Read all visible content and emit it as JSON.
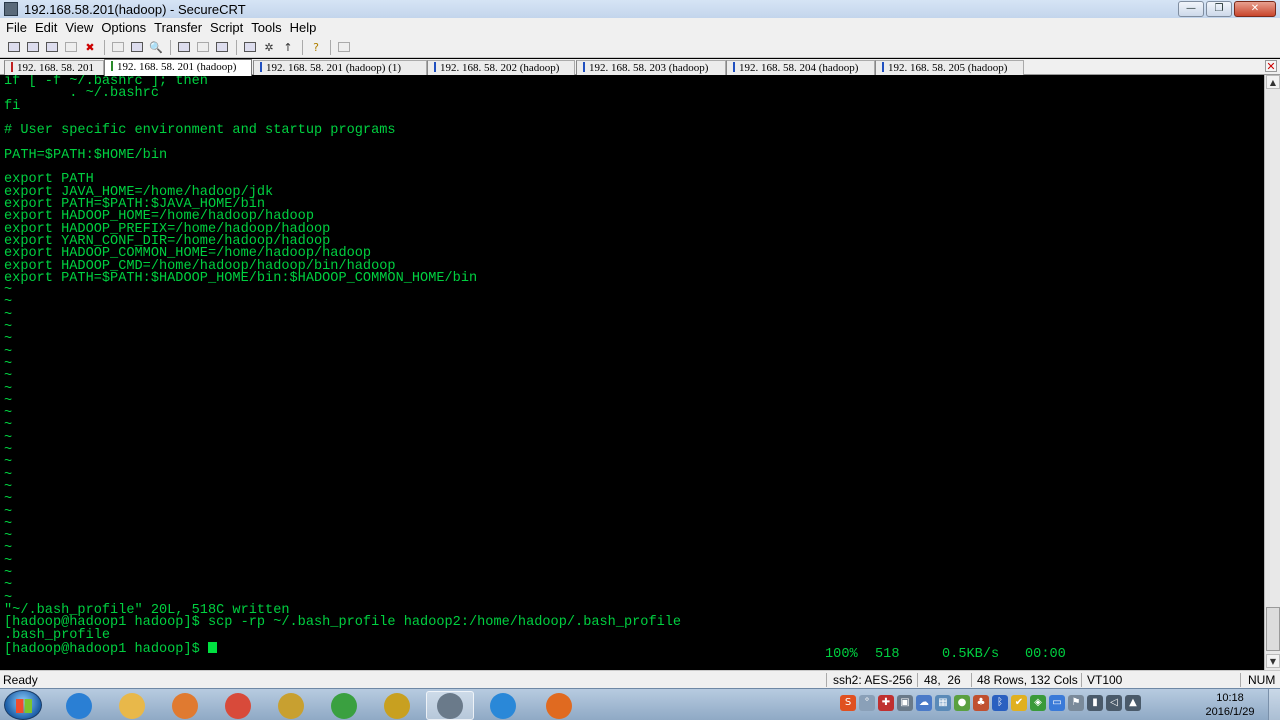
{
  "window": {
    "title": "192.168.58.201(hadoop) - SecureCRT"
  },
  "menubar": {
    "items": [
      "File",
      "Edit",
      "View",
      "Options",
      "Transfer",
      "Script",
      "Tools",
      "Help"
    ]
  },
  "toolbar": {
    "buttons": [
      "connect-icon",
      "quick-connect-icon",
      "connect-tab-icon",
      "reconnect-icon",
      "disconnect-icon",
      "copy-icon",
      "paste-icon",
      "find-icon",
      "print-icon",
      "print-selection-icon",
      "print-setup-icon",
      "session-options-icon",
      "global-options-icon",
      "keymap-icon",
      "sftp-icon",
      "help-icon",
      "script-icon"
    ]
  },
  "tabs": [
    {
      "label": "192. 168. 58. 201",
      "mark_color": "#c02020"
    },
    {
      "label": "192. 168. 58. 201 (hadoop)",
      "mark_color": "#2a8a2a",
      "active": true
    },
    {
      "label": "192. 168. 58. 201 (hadoop)   (1)",
      "mark_color": "#2050c0"
    },
    {
      "label": "192. 168. 58. 202 (hadoop)",
      "mark_color": "#2050c0"
    },
    {
      "label": "192. 168. 58. 203 (hadoop)",
      "mark_color": "#2050c0"
    },
    {
      "label": "192. 168. 58. 204 (hadoop)",
      "mark_color": "#2050c0"
    },
    {
      "label": "192. 168. 58. 205 (hadoop)",
      "mark_color": "#2050c0"
    }
  ],
  "terminal": {
    "lines": [
      "if [ -f ~/.bashrc ]; then",
      "        . ~/.bashrc",
      "fi",
      "",
      "# User specific environment and startup programs",
      "",
      "PATH=$PATH:$HOME/bin",
      "",
      "export PATH",
      "export JAVA_HOME=/home/hadoop/jdk",
      "export PATH=$PATH:$JAVA_HOME/bin",
      "export HADOOP_HOME=/home/hadoop/hadoop",
      "export HADOOP_PREFIX=/home/hadoop/hadoop",
      "export YARN_CONF_DIR=/home/hadoop/hadoop",
      "export HADOOP_COMMON_HOME=/home/hadoop/hadoop",
      "export HADOOP_CMD=/home/hadoop/hadoop/bin/hadoop",
      "export PATH=$PATH:$HADOOP_HOME/bin:$HADOOP_COMMON_HOME/bin",
      "~",
      "~",
      "~",
      "~",
      "~",
      "~",
      "~",
      "~",
      "~",
      "~",
      "~",
      "~",
      "~",
      "~",
      "~",
      "~",
      "~",
      "~",
      "~",
      "~",
      "~",
      "~",
      "~",
      "~",
      "~",
      "~",
      "\"~/.bash_profile\" 20L, 518C written",
      "[hadoop@hadoop1 hadoop]$ scp -rp ~/.bash_profile hadoop2:/home/hadoop/.bash_profile",
      ".bash_profile"
    ],
    "prompt": "[hadoop@hadoop1 hadoop]$ ",
    "transfer": {
      "percent": "100%",
      "bytes": "518",
      "rate": "0.5KB/s",
      "eta": "00:00"
    },
    "fg_color": "#00d040"
  },
  "status": {
    "ready": "Ready",
    "cipher": "ssh2: AES-256",
    "cursor_pos": "48,  26",
    "size": "48 Rows, 132 Cols",
    "emulation": "VT100",
    "numlock": "NUM"
  },
  "taskbar": {
    "apps": [
      {
        "name": "ie-icon",
        "color": "#2a7fd4"
      },
      {
        "name": "explorer-icon",
        "color": "#e8b84a"
      },
      {
        "name": "media-player-icon",
        "color": "#e07a30"
      },
      {
        "name": "chrome-icon",
        "color": "#d84a3a"
      },
      {
        "name": "securefx-icon",
        "color": "#c8a030"
      },
      {
        "name": "sync-icon",
        "color": "#3aa040"
      },
      {
        "name": "pe-tool-icon",
        "color": "#c8a020"
      },
      {
        "name": "securecrt-icon",
        "color": "#6a7a8a"
      },
      {
        "name": "virtualbox-icon",
        "color": "#2a88d8"
      },
      {
        "name": "game-icon",
        "color": "#e06a20"
      }
    ],
    "clock": {
      "time": "10:18",
      "date": "2016/1/29"
    }
  }
}
